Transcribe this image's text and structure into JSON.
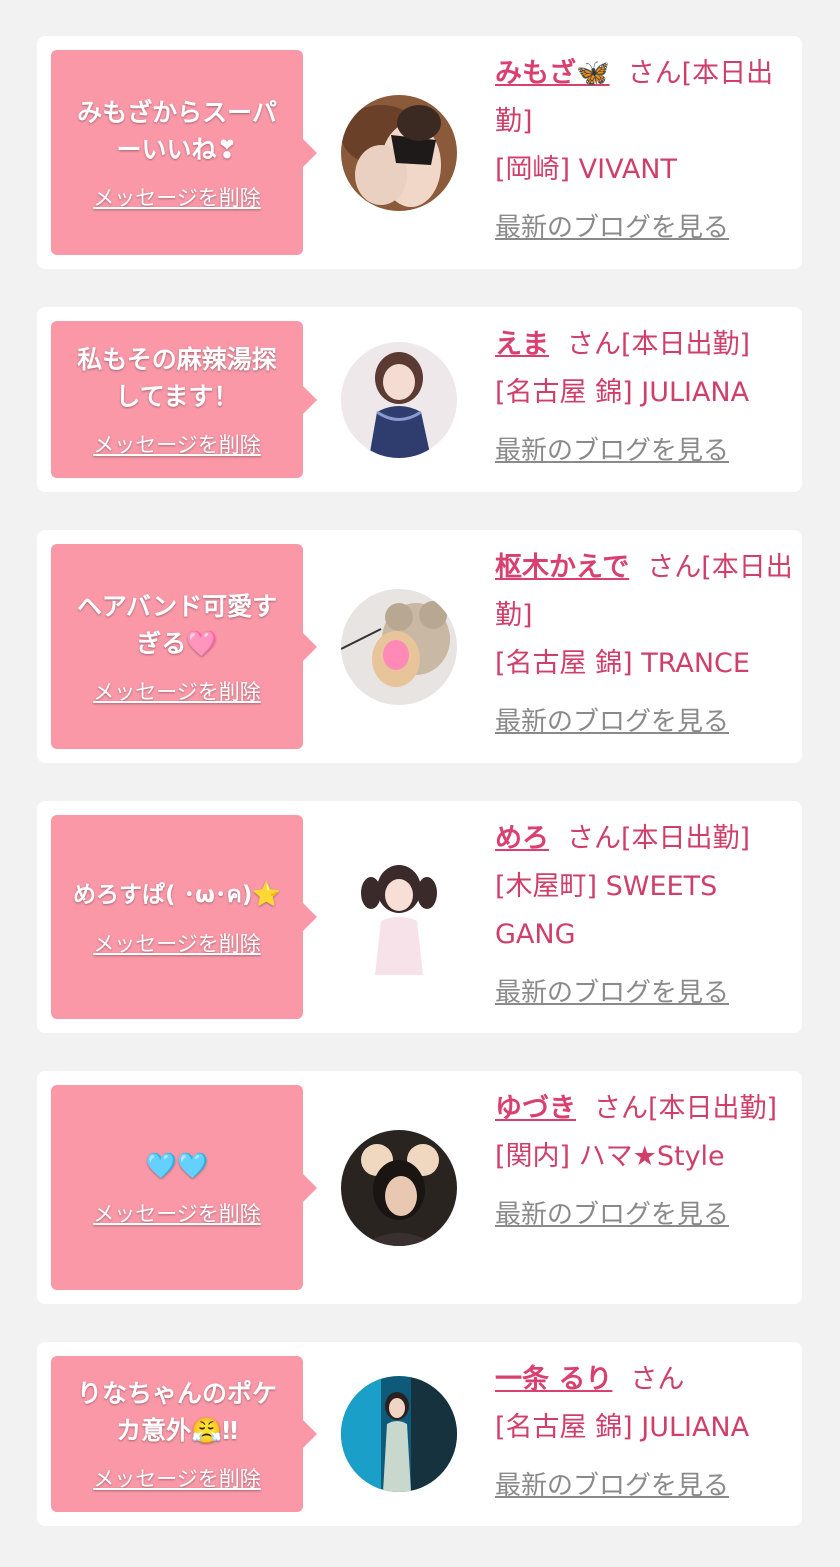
{
  "delete_label": "メッセージを削除",
  "blog_label": "最新のブログを見る",
  "colors": {
    "background": "#f2f2f2",
    "card": "#ffffff",
    "bubble": "#fa98a8",
    "name": "#d94070",
    "text": "#cf3f6a",
    "link_gray": "#8a8a8a"
  },
  "cards": [
    {
      "message": "みもざからスーパ\nーいいね❣",
      "name": "みもざ🦋",
      "suffix": "さん[本日出勤]",
      "shop": "[岡崎] VIVANT",
      "avatar_icon": "photo-woman-lingerie"
    },
    {
      "message": "私もその麻辣湯探\nしてます！",
      "name": "えま",
      "suffix": "さん[本日出勤]",
      "shop": "[名古屋 錦] JULIANA",
      "avatar_icon": "photo-woman-lace-dress"
    },
    {
      "message": "ヘアバンド可愛す\nぎる🩷",
      "name": "枢木かえで",
      "suffix": "さん[本日出勤]",
      "shop": "[名古屋 錦] TRANCE",
      "avatar_icon": "photo-woman-teddy-bear"
    },
    {
      "message": "めろすぱ( ･ω･ค)⭐",
      "name": "めろ",
      "suffix": "さん[本日出勤]",
      "shop": "[木屋町] SWEETS GANG",
      "avatar_icon": "photo-woman-pigtails"
    },
    {
      "message": "🩵🩵",
      "name": "ゆづき",
      "suffix": "さん[本日出勤]",
      "shop": "[関内] ハマ★Style",
      "avatar_icon": "photo-woman-mouse-ears"
    },
    {
      "message": "りなちゃんのポケ\nカ意外😤‼",
      "name": "一条 るり",
      "suffix": "さん",
      "shop": "[名古屋 錦] JULIANA",
      "avatar_icon": "photo-woman-blue-backdrop"
    }
  ]
}
